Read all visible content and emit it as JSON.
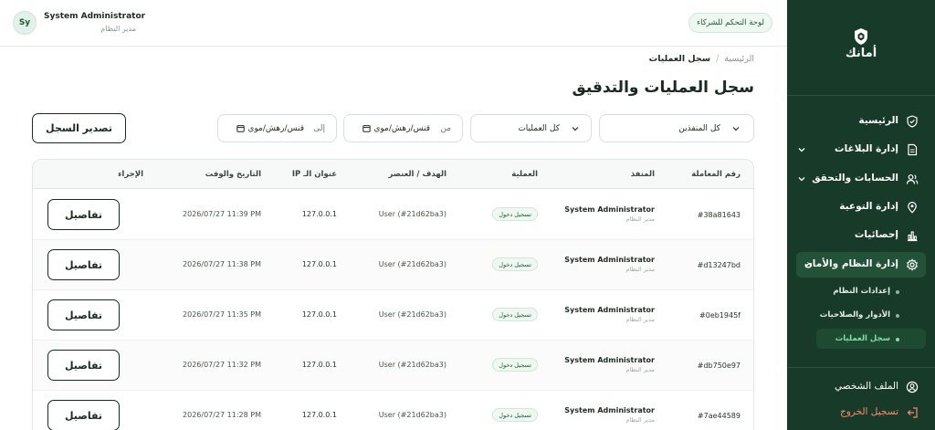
{
  "sidebar": {
    "brand": "أمانك",
    "items": [
      {
        "label": "الرئيسية",
        "icon": "shield-check-icon"
      },
      {
        "label": "إدارة البلاغات",
        "icon": "file-report-icon"
      },
      {
        "label": "الحسابات والتحقق",
        "icon": "users-icon"
      },
      {
        "label": "إدارة التوعية",
        "icon": "awareness-pin-icon"
      },
      {
        "label": "إحصائيات",
        "icon": "bar-chart-icon"
      },
      {
        "label": "إدارة النظام والأمان",
        "icon": "gear-icon"
      }
    ],
    "sub_items": [
      {
        "label": "إعدادات النظام"
      },
      {
        "label": "الأدوار والصلاحيات"
      },
      {
        "label": "سجل العمليات"
      }
    ],
    "profile_label": "الملف الشخصي",
    "logout_label": "تسجيل الخروج",
    "accent_color": "#173b28",
    "logout_color": "#ff8a6e"
  },
  "header": {
    "partner_badge": "لوحة التحكم للشركاء",
    "user_name": "System Administrator",
    "user_role": "مدير النظام",
    "avatar_initials": "Sy"
  },
  "breadcrumb": {
    "home": "الرئيسية",
    "separator": "/",
    "current": "سجل العمليات"
  },
  "page": {
    "title": "سجل العمليات والتدقيق"
  },
  "filters": {
    "executors": "كل المنفذين",
    "operations": "كل العمليات",
    "from_label": "من",
    "from_value": "قنس/رهش/موي",
    "to_label": "إلى",
    "to_value": "قنس/رهش/موي",
    "export_label": "تصدير السجل"
  },
  "table": {
    "headers": {
      "id": "رقم المعاملة",
      "actor": "المنفذ",
      "operation": "العملية",
      "target": "الهدف / العنصر",
      "ip": "عنوان الـ IP",
      "datetime": "التاريخ والوقت",
      "action": "الإجراء"
    },
    "rows": [
      {
        "id": "#38a81643",
        "actor": "System Administrator",
        "actor_role": "مدير النظام",
        "operation": "تسجيل دخول",
        "target": "User (#21d62ba3)",
        "ip": "127.0.0.1",
        "datetime": "2026/07/27 11:39 PM",
        "action": "تفاصيل"
      },
      {
        "id": "#d13247bd",
        "actor": "System Administrator",
        "actor_role": "مدير النظام",
        "operation": "تسجيل دخول",
        "target": "User (#21d62ba3)",
        "ip": "127.0.0.1",
        "datetime": "2026/07/27 11:38 PM",
        "action": "تفاصيل"
      },
      {
        "id": "#0eb1945f",
        "actor": "System Administrator",
        "actor_role": "مدير النظام",
        "operation": "تسجيل دخول",
        "target": "User (#21d62ba3)",
        "ip": "127.0.0.1",
        "datetime": "2026/07/27 11:35 PM",
        "action": "تفاصيل"
      },
      {
        "id": "#db750e97",
        "actor": "System Administrator",
        "actor_role": "مدير النظام",
        "operation": "تسجيل دخول",
        "target": "User (#21d62ba3)",
        "ip": "127.0.0.1",
        "datetime": "2026/07/27 11:32 PM",
        "action": "تفاصيل"
      },
      {
        "id": "#7ae44589",
        "actor": "System Administrator",
        "actor_role": "مدير النظام",
        "operation": "تسجيل دخول",
        "target": "User (#21d62ba3)",
        "ip": "127.0.0.1",
        "datetime": "2026/07/27 11:28 PM",
        "action": "تفاصيل"
      }
    ]
  }
}
